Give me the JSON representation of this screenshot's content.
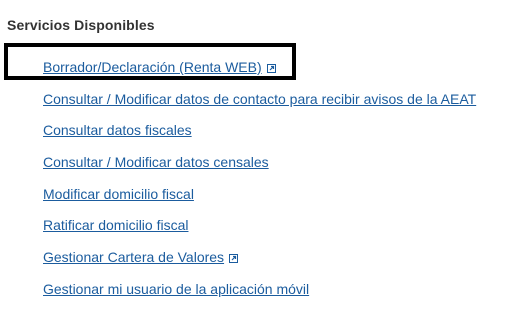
{
  "section": {
    "title": "Servicios Disponibles"
  },
  "services": [
    {
      "label": "Borrador/Declaración (Renta WEB)",
      "external": true,
      "icon": "external-link-icon"
    },
    {
      "label": "Consultar / Modificar datos de contacto para recibir avisos de la AEAT",
      "external": false
    },
    {
      "label": "Consultar datos fiscales",
      "external": false
    },
    {
      "label": "Consultar / Modificar datos censales",
      "external": false
    },
    {
      "label": "Modificar domicilio fiscal",
      "external": false
    },
    {
      "label": "Ratificar domicilio fiscal",
      "external": false
    },
    {
      "label": "Gestionar Cartera de Valores",
      "external": true,
      "icon": "external-link-icon"
    },
    {
      "label": "Gestionar mi usuario de la aplicación móvil",
      "external": false
    }
  ],
  "colors": {
    "link": "#1b5c9e",
    "title": "#333333",
    "highlight_border": "#000000"
  }
}
